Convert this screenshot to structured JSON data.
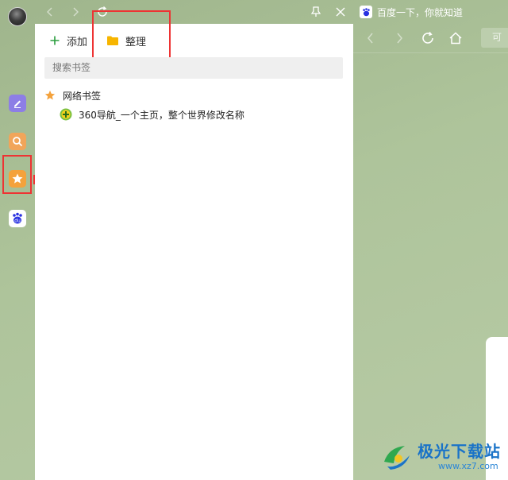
{
  "rail": {
    "items": [
      {
        "name": "notes",
        "icon": "pen-icon"
      },
      {
        "name": "search",
        "icon": "search-icon"
      },
      {
        "name": "bookmarks",
        "icon": "star-icon",
        "active": true
      },
      {
        "name": "baidu",
        "icon": "baidu-paw-icon"
      }
    ]
  },
  "panel": {
    "toolbar": {
      "add_label": "添加",
      "organize_label": "整理"
    },
    "search": {
      "placeholder": "搜索书签"
    },
    "folder": {
      "label": "网络书签"
    },
    "bookmarks": [
      {
        "label": "360导航_一个主页，整个世界修改名称"
      }
    ]
  },
  "browser": {
    "tab_title": "百度一下，你就知道",
    "address_text": "可"
  },
  "watermark": {
    "title": "极光下载站",
    "url": "www.xz7.com"
  },
  "colors": {
    "accent_red": "#e33333",
    "star": "#f4a23c",
    "background": "#a9bf97"
  }
}
